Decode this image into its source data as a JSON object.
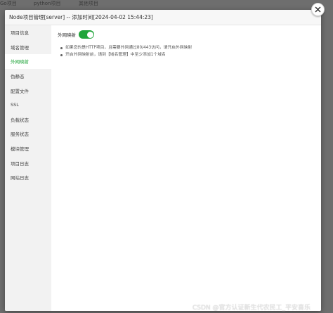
{
  "background_tabs": [
    "Go项目",
    "python项目",
    "其他项目"
  ],
  "modal": {
    "title": "Node项目管理[server] -- 添加时间[2024-04-02 15:44:23]"
  },
  "sidebar": {
    "items": [
      {
        "label": "项目信息",
        "active": false
      },
      {
        "label": "域名管理",
        "active": false
      },
      {
        "label": "外网映射",
        "active": true
      },
      {
        "label": "伪静态",
        "active": false
      },
      {
        "label": "配置文件",
        "active": false
      },
      {
        "label": "SSL",
        "active": false
      },
      {
        "label": "负载状态",
        "active": false
      },
      {
        "label": "服务状态",
        "active": false
      },
      {
        "label": "模块管理",
        "active": false
      },
      {
        "label": "项目日志",
        "active": false
      },
      {
        "label": "网站日志",
        "active": false
      }
    ]
  },
  "content": {
    "toggle_label": "外网映射",
    "toggle_on": true,
    "tips": [
      "如果您的是HTTP项目，且需要外网通过80/443访问，请开启外网映射",
      "开启外网映射前，请到【域名管理】中至少添加1个域名"
    ]
  },
  "watermark": "CSDN @官方认证新生代农民工_平安喜乐",
  "colors": {
    "accent": "#20a53a"
  }
}
